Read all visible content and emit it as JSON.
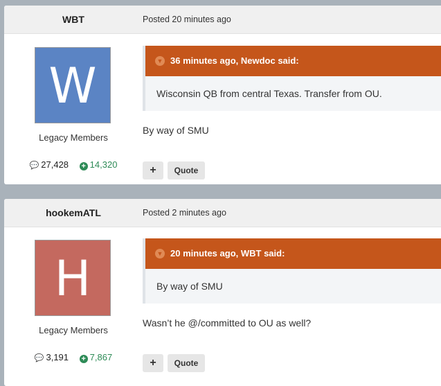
{
  "posts": [
    {
      "author": "WBT",
      "posted": "Posted 20 minutes ago",
      "avatar_letter": "W",
      "avatar_color": "#5b84c4",
      "group": "Legacy Members",
      "post_count": "27,428",
      "reputation": "14,320",
      "quote_header": "36 minutes ago, Newdoc said:",
      "quote_text": "Wisconsin QB from central Texas. Transfer from OU.",
      "body": "By way of SMU",
      "plus_label": "+",
      "quote_label": "Quote"
    },
    {
      "author": "hookemATL",
      "posted": "Posted 2 minutes ago",
      "avatar_letter": "H",
      "avatar_color": "#c4695f",
      "group": "Legacy Members",
      "post_count": "3,191",
      "reputation": "7,867",
      "quote_header": "20 minutes ago, WBT said:",
      "quote_text": "By way of SMU",
      "body": "Wasn’t he @/committed to OU as well?",
      "plus_label": "+",
      "quote_label": "Quote"
    }
  ],
  "icons": {
    "chevron": "chevron-down-icon",
    "comment": "comment-icon",
    "reputation": "plus-circle-icon"
  }
}
